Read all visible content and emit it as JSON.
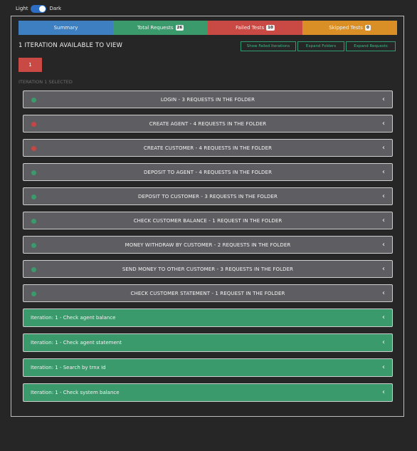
{
  "theme": {
    "light_label": "Light",
    "dark_label": "Dark",
    "dark_enabled": true
  },
  "tabs": [
    {
      "label": "Summary",
      "badge": "",
      "color": "#3d7fc0"
    },
    {
      "label": "Total Requests",
      "badge": "26",
      "color": "#3a9a6c"
    },
    {
      "label": "Failed Tests",
      "badge": "10",
      "color": "#c94a44"
    },
    {
      "label": "Skipped Tests",
      "badge": "0",
      "color": "#d98f25"
    }
  ],
  "iterations": {
    "title": "1 ITERATION AVAILABLE TO VIEW",
    "selected_label": "ITERATION 1 SELECTED",
    "button_label": "1"
  },
  "actions": {
    "show_failed": "Show Failed Iterations",
    "expand_folders": "Expand Folders",
    "expand_requests": "Expand Requests"
  },
  "folders": [
    {
      "label": "LOGIN - 3 REQUESTS IN THE FOLDER",
      "status": "pass"
    },
    {
      "label": "CREATE AGENT - 4 REQUESTS IN THE FOLDER",
      "status": "fail"
    },
    {
      "label": "CREATE CUSTOMER - 4 REQUESTS IN THE FOLDER",
      "status": "fail"
    },
    {
      "label": "DEPOSIT TO AGENT - 4 REQUESTS IN THE FOLDER",
      "status": "pass"
    },
    {
      "label": "DEPOSIT TO CUSTOMER - 3 REQUESTS IN THE FOLDER",
      "status": "pass"
    },
    {
      "label": "CHECK CUSTOMER BALANCE - 1 REQUEST IN THE FOLDER",
      "status": "pass"
    },
    {
      "label": "MONEY WITHDRAW BY CUSTOMER - 2 REQUESTS IN THE FOLDER",
      "status": "pass"
    },
    {
      "label": "SEND MONEY TO OTHER CUSTOMER - 3 REQUESTS IN THE FOLDER",
      "status": "pass"
    },
    {
      "label": "CHECK CUSTOMER STATEMENT - 1 REQUEST IN THE FOLDER",
      "status": "pass"
    }
  ],
  "requests": [
    {
      "label": "Iteration: 1 - Check agent balance"
    },
    {
      "label": "Iteration: 1 - Check agent statement"
    },
    {
      "label": "Iteration: 1 - Search by trnx Id"
    },
    {
      "label": "Iteration: 1 - Check system balance"
    }
  ],
  "icons": {
    "chevron": "chevron-left-icon",
    "status_dot": "status-dot-icon"
  }
}
